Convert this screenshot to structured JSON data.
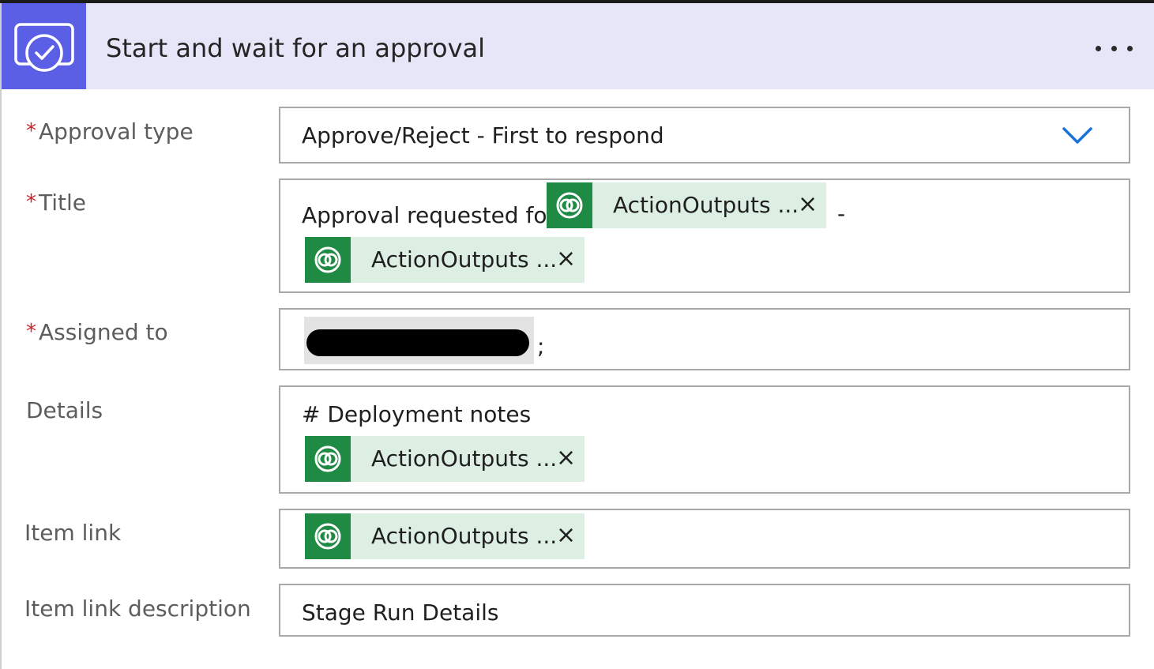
{
  "header": {
    "title": "Start and wait for an approval",
    "icon": "approval-icon",
    "more_icon": "more-options-icon",
    "accent_color": "#5b5fe6"
  },
  "required_marker": "*",
  "fields": {
    "approval_type": {
      "label": "Approval type",
      "value": "Approve/Reject - First to respond",
      "dropdown_icon": "chevron-down-icon"
    },
    "title": {
      "label": "Title",
      "prefix_text": "Approval requested for",
      "separator": "-",
      "tokens": [
        {
          "label": "ActionOutputs ...",
          "icon": "dataverse-icon",
          "close": "×"
        },
        {
          "label": "ActionOutputs ...",
          "icon": "dataverse-icon",
          "close": "×"
        }
      ]
    },
    "assigned_to": {
      "label": "Assigned to",
      "suffix": ";"
    },
    "details": {
      "label": "Details",
      "text": "# Deployment notes",
      "tokens": [
        {
          "label": "ActionOutputs ...",
          "icon": "dataverse-icon",
          "close": "×"
        }
      ]
    },
    "item_link": {
      "label": "Item link",
      "tokens": [
        {
          "label": "ActionOutputs ...",
          "icon": "dataverse-icon",
          "close": "×"
        }
      ]
    },
    "item_link_description": {
      "label": "Item link description",
      "value": "Stage Run Details"
    }
  }
}
